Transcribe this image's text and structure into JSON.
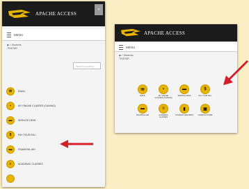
{
  "brand": {
    "title": "APACHE ACCESS"
  },
  "menu": {
    "label": "MENU"
  },
  "breadcrumb": {
    "home": "◆ > Students",
    "page": "TRISTAR"
  },
  "search": {
    "placeholder": "Search for anything"
  },
  "mobile_items": [
    {
      "label": "EMAIL",
      "icon": "mail-icon",
      "glyph": "✉"
    },
    {
      "label": "MY ONLINE CLASSES (CANVAS)",
      "icon": "book-icon",
      "glyph": "▪"
    },
    {
      "label": "SERVICE DESK",
      "icon": "cap-icon",
      "glyph": "▬"
    },
    {
      "label": "PAY YOUR BILL",
      "icon": "dollar-icon",
      "glyph": "$"
    },
    {
      "label": "FINANCIAL AID",
      "icon": "card-icon",
      "glyph": "▬"
    },
    {
      "label": "ACADEMIC CLASSES",
      "icon": "list-icon",
      "glyph": "≡"
    },
    {
      "label": "",
      "icon": "more-icon",
      "glyph": ""
    }
  ],
  "desktop_items": [
    {
      "label": "EMAIL",
      "icon": "mail-icon",
      "glyph": "✉"
    },
    {
      "label": "MY ONLINE CLASSES (CANVAS)",
      "icon": "book-icon",
      "glyph": "▪"
    },
    {
      "label": "SERVICE DESK",
      "icon": "cap-icon",
      "glyph": "▬"
    },
    {
      "label": "PAY YOUR BILL",
      "icon": "dollar-icon",
      "glyph": "$"
    },
    {
      "label": "FINANCIAL AID",
      "icon": "card-icon",
      "glyph": "▬"
    },
    {
      "label": "ACADEMIC CLASSES",
      "icon": "list-icon",
      "glyph": "≡"
    },
    {
      "label": "STUDENT RECORDS",
      "icon": "id-icon",
      "glyph": "▮"
    },
    {
      "label": "CAMPUS STORE",
      "icon": "bag-icon",
      "glyph": "▣"
    }
  ],
  "colors": {
    "background": "#fbeec4",
    "header": "#1b1b1b",
    "accent": "#e8b400",
    "arrow": "#d31f2a"
  }
}
